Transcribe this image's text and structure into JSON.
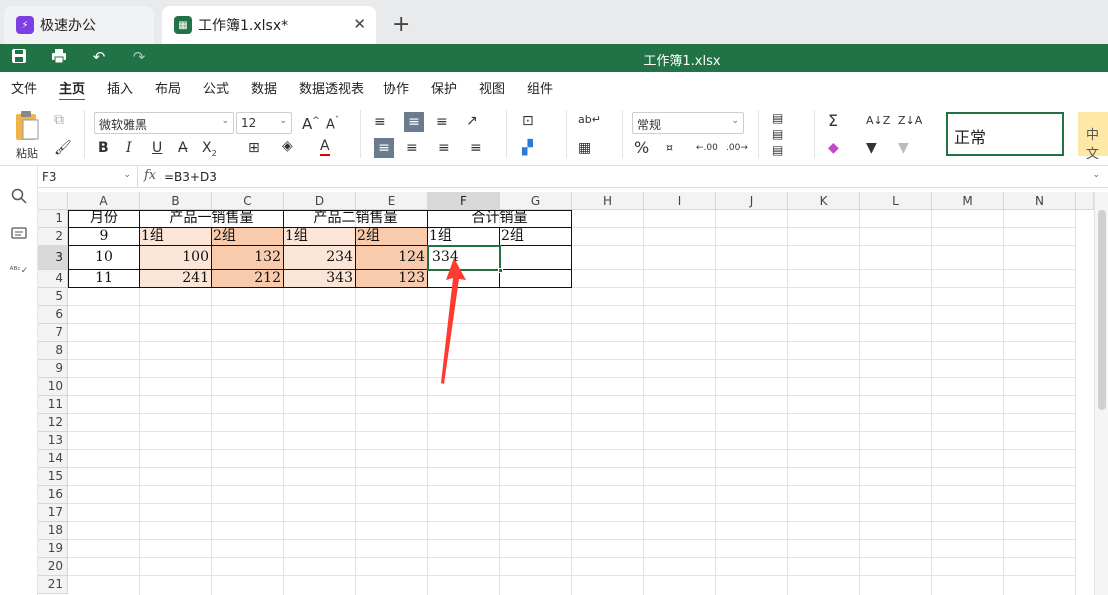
{
  "tabs": [
    {
      "label": "极速办公",
      "icon": "app-logo-icon",
      "color": "#7b3fe4"
    },
    {
      "label": "工作簿1.xlsx*",
      "icon": "spreadsheet-icon",
      "color": "#217346",
      "close": "✕"
    }
  ],
  "new_tab": "+",
  "titlebar": {
    "doc_title": "工作簿1.xlsx",
    "save_icon": "save-icon",
    "print_icon": "print-icon",
    "undo_icon": "undo-icon",
    "redo_icon": "redo-icon"
  },
  "menu": [
    "文件",
    "主页",
    "插入",
    "布局",
    "公式",
    "数据",
    "数据透视表",
    "协作",
    "保护",
    "视图",
    "组件"
  ],
  "ribbon": {
    "paste_label": "粘贴",
    "font_name": "微软雅黑",
    "font_size": "12",
    "number_format": "常规",
    "bold": "B",
    "italic": "I",
    "underline": "U",
    "style_normal": "正常",
    "style_next": "中文"
  },
  "formula_bar": {
    "cell_ref": "F3",
    "fx": "fx",
    "formula": "=B3+D3"
  },
  "columns": [
    "A",
    "B",
    "C",
    "D",
    "E",
    "F",
    "G",
    "H",
    "I",
    "J",
    "K",
    "L",
    "M",
    "N"
  ],
  "rows": [
    "1",
    "2",
    "3",
    "4",
    "5",
    "6",
    "7",
    "8",
    "9",
    "10",
    "11",
    "12",
    "13",
    "14",
    "15",
    "16",
    "17",
    "18",
    "19",
    "20",
    "21"
  ],
  "sheet": {
    "row1": {
      "A": "月份",
      "BC": "产品一销售量",
      "DE": "产品二销售量",
      "FG": "合计销量"
    },
    "row2": {
      "A": "9",
      "B": "1组",
      "C": "2组",
      "D": "1组",
      "E": "2组",
      "F": "1组",
      "G": "2组"
    },
    "row3": {
      "A": "10",
      "B": "100",
      "C": "132",
      "D": "234",
      "E": "124",
      "F": "334",
      "G": ""
    },
    "row4": {
      "A": "11",
      "B": "241",
      "C": "212",
      "D": "343",
      "E": "123",
      "F": "",
      "G": ""
    }
  },
  "colors": {
    "accent": "#217346",
    "cell_light": "#fbe5d6",
    "cell_dark": "#f8cbad",
    "annotation_arrow": "#ff3b30"
  }
}
